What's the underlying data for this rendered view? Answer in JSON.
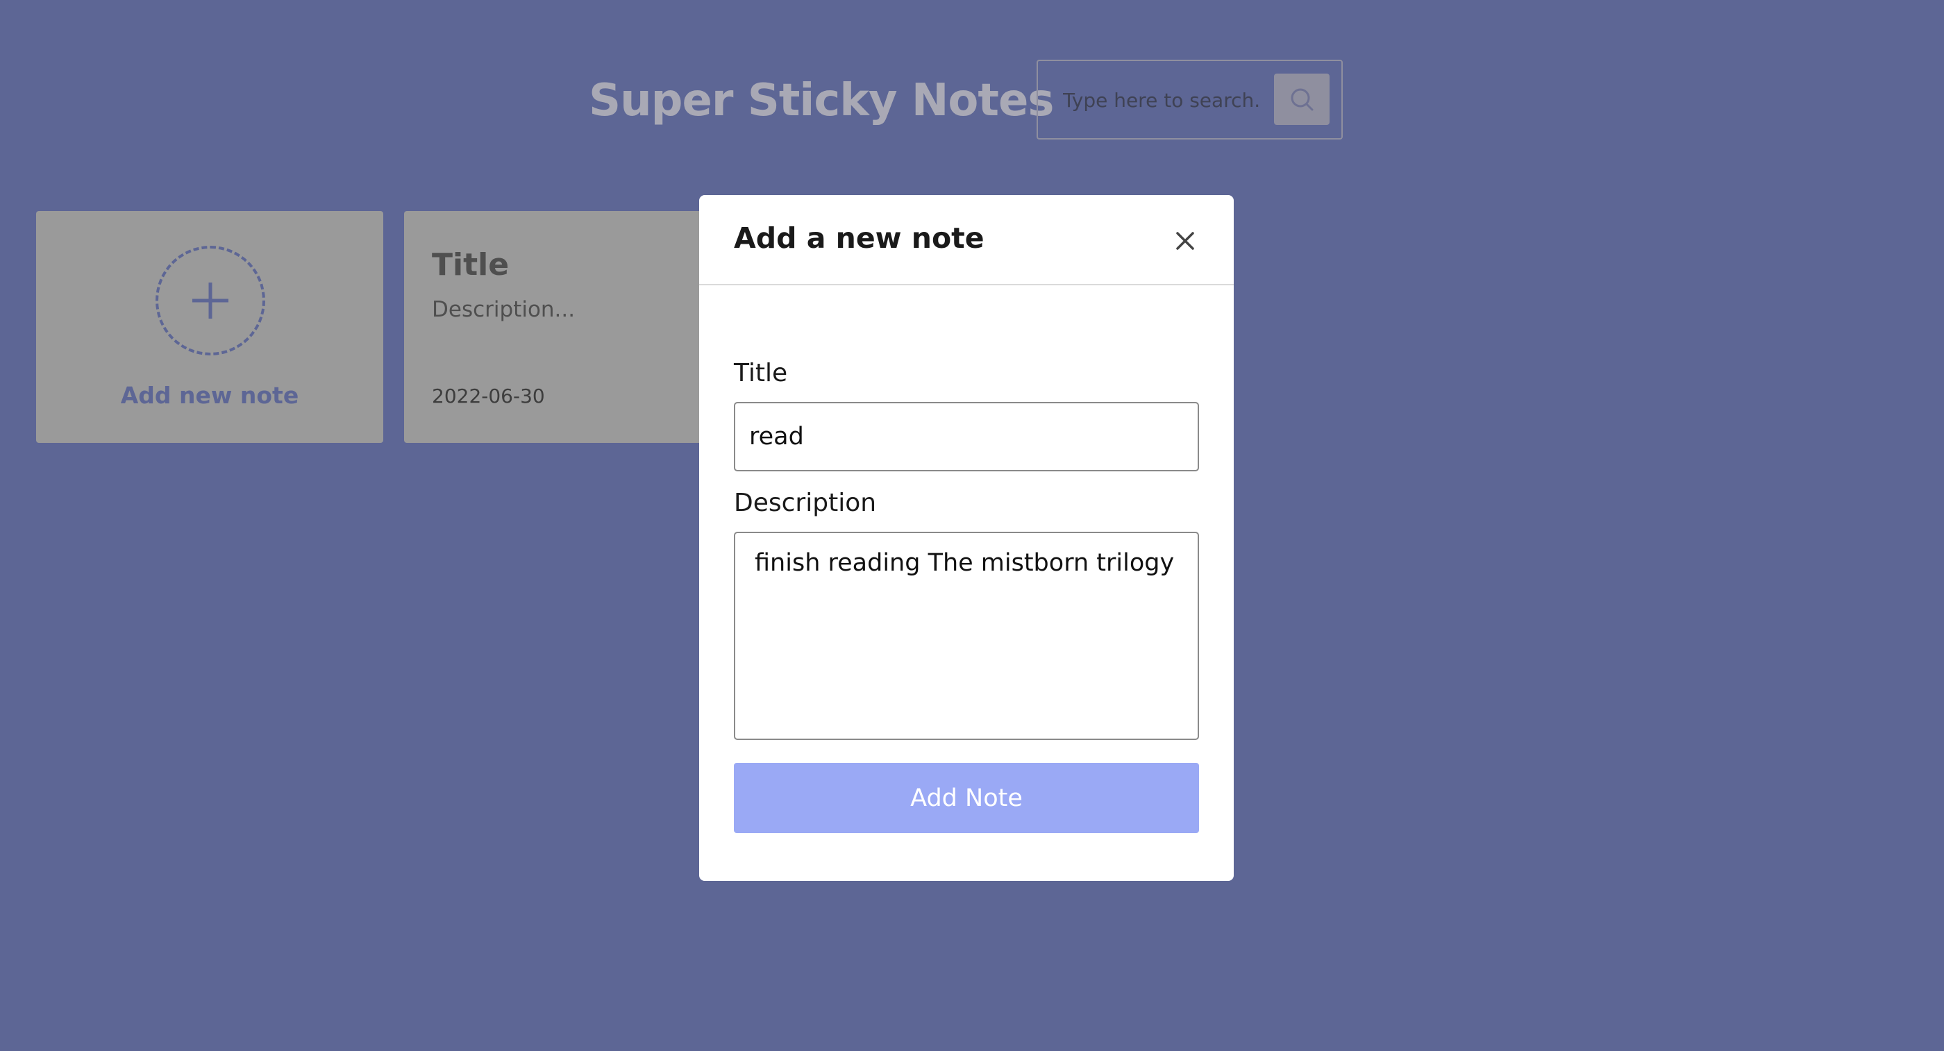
{
  "app": {
    "title": "Super Sticky Notes"
  },
  "search": {
    "placeholder": "Type here to search.",
    "button_icon": "search-icon"
  },
  "add_card": {
    "icon": "plus-icon",
    "label": "Add new note"
  },
  "notes": [
    {
      "title": "Title",
      "description": "Description...",
      "date": "2022-06-30"
    }
  ],
  "modal": {
    "title": "Add a new note",
    "close_icon": "close-icon",
    "title_label": "Title",
    "title_value": "read",
    "description_label": "Description",
    "description_value": "finish reading The mistborn trilogy",
    "submit_label": "Add Note"
  },
  "colors": {
    "background": "#5D6695",
    "card": "#9A9A9A",
    "accent": "#9AA9F5",
    "modal_bg": "#FFFFFF"
  }
}
